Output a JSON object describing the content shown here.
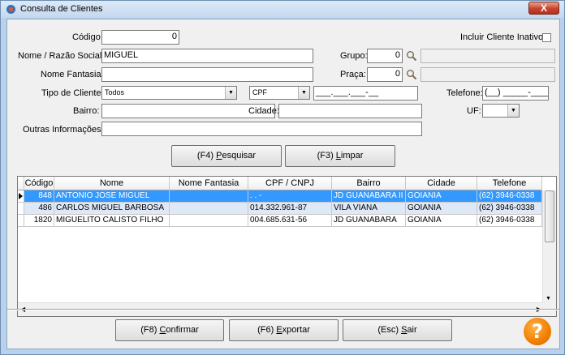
{
  "window": {
    "title": "Consulta de Clientes",
    "close_glyph": "X"
  },
  "form": {
    "codigo": {
      "label": "Código:",
      "value": "0"
    },
    "incluir_inativo": {
      "label": "Incluir Cliente Inativo:"
    },
    "nome": {
      "label": "Nome / Razão Social:",
      "value": "MIGUEL"
    },
    "grupo": {
      "label": "Grupo:",
      "value": "0"
    },
    "fantasia": {
      "label": "Nome Fantasia:",
      "value": ""
    },
    "praca": {
      "label": "Praça:",
      "value": "0"
    },
    "tipo": {
      "label": "Tipo de Cliente:",
      "value": "Todos"
    },
    "doc_tipo": {
      "value": "CPF"
    },
    "doc_mask": {
      "value": "___.___.___-__"
    },
    "telefone": {
      "label": "Telefone:",
      "value": "(__) _____-____"
    },
    "bairro": {
      "label": "Bairro:",
      "value": ""
    },
    "cidade": {
      "label": "Cidade:",
      "value": ""
    },
    "uf": {
      "label": "UF:",
      "value": ""
    },
    "outras": {
      "label": "Outras Informações:",
      "value": ""
    }
  },
  "buttons": {
    "pesquisar": {
      "pre": "(F4) ",
      "key": "P",
      "post": "esquisar"
    },
    "limpar": {
      "pre": "(F3) ",
      "key": "L",
      "post": "impar"
    },
    "confirmar": {
      "pre": "(F8) ",
      "key": "C",
      "post": "onfirmar"
    },
    "exportar": {
      "pre": "(F6) ",
      "key": "E",
      "post": "xportar"
    },
    "sair": {
      "pre": "(Esc) ",
      "key": "S",
      "post": "air"
    }
  },
  "grid": {
    "columns": [
      "Código",
      "Nome",
      "Nome Fantasia",
      "CPF / CNPJ",
      "Bairro",
      "Cidade",
      "Telefone"
    ],
    "rows": [
      {
        "codigo": "848",
        "nome": "ANTONIO JOSE MIGUEL",
        "fantasia": "",
        "doc": ". . -",
        "bairro": "JD GUANABARA II",
        "cidade": "GOIANIA",
        "telefone": "(62)  3946-0338"
      },
      {
        "codigo": "486",
        "nome": "CARLOS MIGUEL BARBOSA",
        "fantasia": "",
        "doc": "014.332.961-87",
        "bairro": "VILA VIANA",
        "cidade": "GOIANIA",
        "telefone": "(62)  3946-0338"
      },
      {
        "codigo": "1820",
        "nome": "MIGUELITO CALISTO FILHO",
        "fantasia": "",
        "doc": "004.685.631-56",
        "bairro": "JD GUANABARA",
        "cidade": "GOIANIA",
        "telefone": "(62)  3946-0338"
      }
    ]
  },
  "help": {
    "glyph": "?"
  },
  "icons": [
    "app-icon",
    "close-icon",
    "search-icon",
    "help-icon",
    "dropdown-arrow-icon",
    "row-indicator-icon"
  ],
  "colors": {
    "selection": "#3399ff",
    "alt_row": "#dde9f6",
    "help": "#f07e00",
    "frame": "#b9d1ea"
  }
}
